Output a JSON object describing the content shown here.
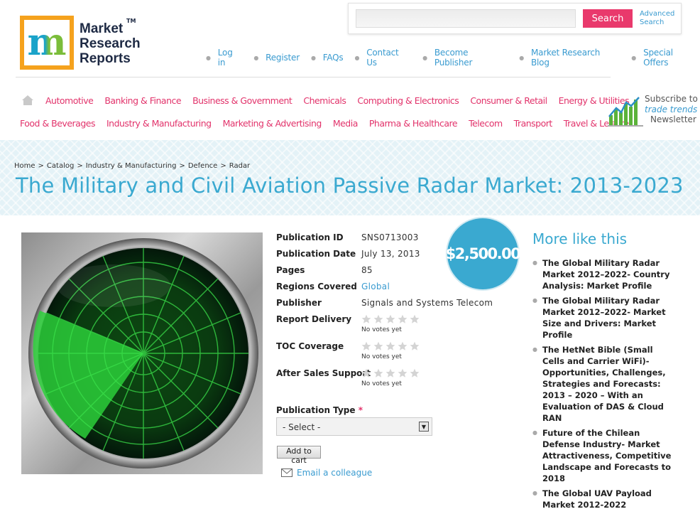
{
  "brand": {
    "logo_lines": [
      "Market",
      "Research",
      "Reports"
    ],
    "tm": "TM"
  },
  "search": {
    "placeholder": "",
    "button": "Search",
    "advanced_line1": "Advanced",
    "advanced_line2": "Search"
  },
  "topnav": [
    "Log in",
    "Register",
    "FAQs",
    "Contact Us",
    "Become Publisher",
    "Market Research Blog",
    "Special Offers"
  ],
  "categories_row1": [
    "Automotive",
    "Banking & Finance",
    "Business & Government",
    "Chemicals",
    "Computing & Electronics",
    "Consumer & Retail",
    "Energy & Utilities"
  ],
  "categories_row2": [
    "Food & Beverages",
    "Industry & Manufacturing",
    "Marketing & Advertising",
    "Media",
    "Pharma & Healthcare",
    "Telecom",
    "Transport",
    "Travel & Leisure"
  ],
  "subscribe": {
    "line1": "Subscribe to",
    "line2": "trade trends",
    "line3": "Newsletter"
  },
  "breadcrumb": [
    "Home",
    "Catalog",
    "Industry & Manufacturing",
    "Defence",
    "Radar"
  ],
  "title": "The Military and Civil Aviation Passive Radar Market: 2013-2023",
  "price": "$2,500.00",
  "details": {
    "pub_id_label": "Publication ID",
    "pub_id": "SNS0713003",
    "pub_date_label": "Publication Date",
    "pub_date": "July 13, 2013",
    "pages_label": "Pages",
    "pages": "85",
    "regions_label": "Regions Covered",
    "regions": "Global",
    "publisher_label": "Publisher",
    "publisher": "Signals and Systems Telecom",
    "report_delivery_label": "Report Delivery",
    "toc_label": "TOC Coverage",
    "after_sales_label": "After Sales Support",
    "no_votes": "No votes yet"
  },
  "ratings": {
    "report_delivery": 0,
    "toc_coverage": 0,
    "after_sales": 0,
    "max": 5
  },
  "publication_type": {
    "label": "Publication Type",
    "required": "*",
    "selected": "- Select -"
  },
  "add_to_cart": "Add to cart",
  "email_colleague": "Email a colleague",
  "more_like_this": {
    "title": "More like this",
    "items": [
      "The Global Military Radar Market 2012–2022- Country Analysis: Market Profile",
      "The Global Military Radar Market 2012–2022- Market Size and Drivers: Market Profile",
      "The HetNet Bible (Small Cells and Carrier WiFi)- Opportunities, Challenges, Strategies and Forecasts: 2013 – 2020 – With an Evaluation of DAS & Cloud RAN",
      "Future of the Chilean Defense Industry- Market Attractiveness, Competitive Landscape and Forecasts to 2018",
      "The Global UAV Payload Market 2012-2022"
    ]
  },
  "colors": {
    "accent_blue": "#3aa9d0",
    "link_blue": "#3a9bd0",
    "category_pink": "#e2336b",
    "search_button": "#e9396c",
    "logo_orange": "#f5a21d"
  }
}
